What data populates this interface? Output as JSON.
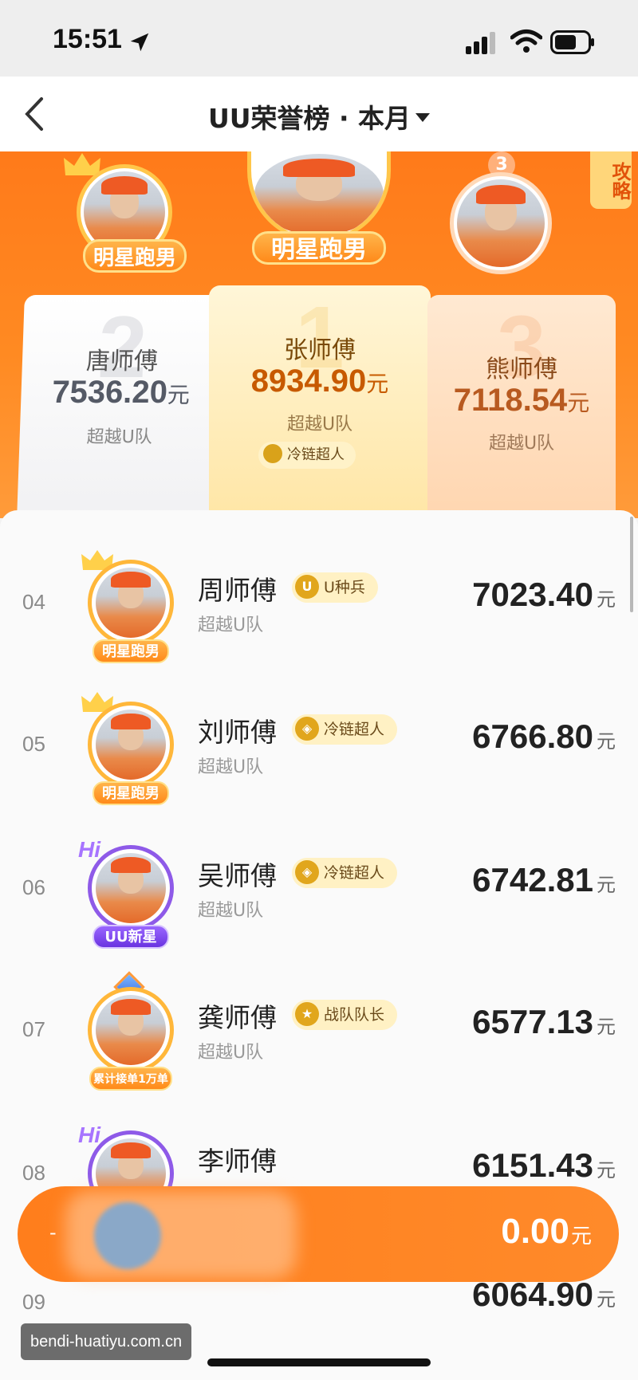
{
  "status": {
    "time": "15:51"
  },
  "nav": {
    "title": "UU荣誉榜 · 本月"
  },
  "banner": {
    "strategy_label": "攻略"
  },
  "podium": [
    {
      "rank": "2",
      "name": "唐师傅",
      "amount": "7536.20",
      "unit": "元",
      "team": "超越U队",
      "tag": "明星跑男"
    },
    {
      "rank": "1",
      "name": "张师傅",
      "amount": "8934.90",
      "unit": "元",
      "team": "超越U队",
      "tag": "明星跑男",
      "badge": "冷链超人"
    },
    {
      "rank": "3",
      "name": "熊师傅",
      "amount": "7118.54",
      "unit": "元",
      "team": "超越U队"
    }
  ],
  "list": [
    {
      "rank": "04",
      "name": "周师傅",
      "team": "超越U队",
      "badge": "U种兵",
      "badge_icon": "U",
      "amount": "7023.40",
      "unit": "元",
      "tag": "明星跑男"
    },
    {
      "rank": "05",
      "name": "刘师傅",
      "team": "超越U队",
      "badge": "冷链超人",
      "badge_icon": "◈",
      "amount": "6766.80",
      "unit": "元",
      "tag": "明星跑男"
    },
    {
      "rank": "06",
      "name": "吴师傅",
      "team": "超越U队",
      "badge": "冷链超人",
      "badge_icon": "◈",
      "amount": "6742.81",
      "unit": "元",
      "tag": "UU新星",
      "hi": "Hi"
    },
    {
      "rank": "07",
      "name": "龚师傅",
      "team": "超越U队",
      "badge": "战队队长",
      "badge_icon": "★",
      "amount": "6577.13",
      "unit": "元",
      "tag": "累计接单1万单"
    },
    {
      "rank": "08",
      "name": "李师傅",
      "amount": "6151.43",
      "unit": "元",
      "hi": "Hi"
    },
    {
      "rank": "09",
      "amount": "6064.90",
      "unit": "元"
    }
  ],
  "my": {
    "rank": "-",
    "amount": "0.00",
    "unit": "元"
  },
  "watermark": "bendi-huatiyu.com.cn",
  "colors": {
    "brand_orange": "#ff7a1a",
    "gold": "#ffc64a",
    "purple": "#8e5ae8"
  }
}
